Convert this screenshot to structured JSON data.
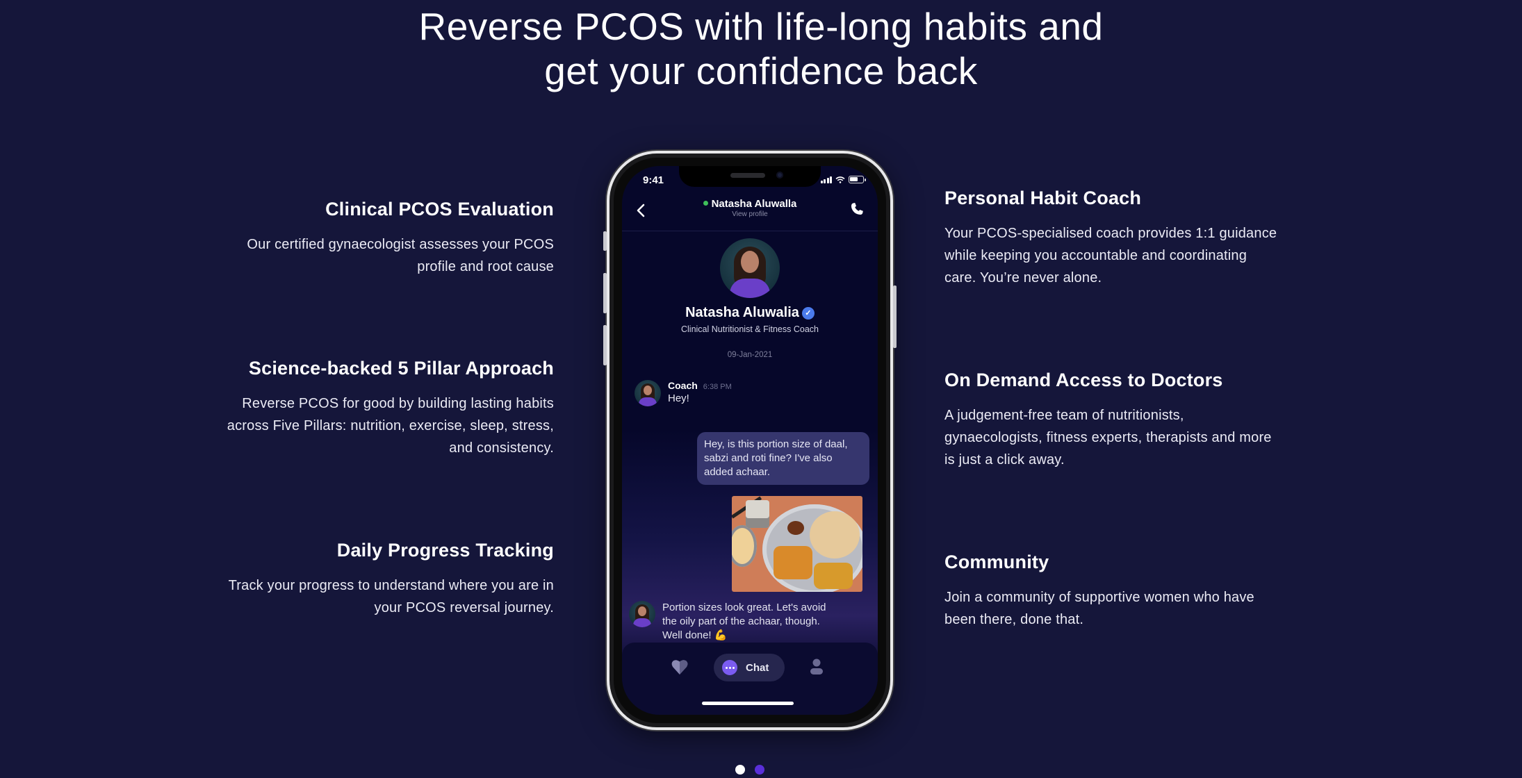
{
  "hero": {
    "title_line1": "Reverse PCOS with life-long habits and",
    "title_line2": "get your confidence back"
  },
  "features_left": [
    {
      "title": "Clinical PCOS Evaluation",
      "body_line1": "Our certified gynaecologist assesses your PCOS",
      "body_line2": "profile and root cause"
    },
    {
      "title": "Science-backed 5 Pillar Approach",
      "body_line1": "Reverse PCOS for good by building lasting habits",
      "body_line2": "across Five Pillars: nutrition, exercise, sleep, stress,",
      "body_line3": "and consistency."
    },
    {
      "title": "Daily Progress Tracking",
      "body_line1": "Track your progress to understand where you are in",
      "body_line2": "your PCOS reversal journey."
    }
  ],
  "features_right": [
    {
      "title": "Personal Habit Coach",
      "body_line1": "Your PCOS-specialised coach provides 1:1 guidance",
      "body_line2": "while keeping you accountable and coordinating",
      "body_line3": "care. You’re never alone."
    },
    {
      "title": "On Demand Access to Doctors",
      "body_line1": "A judgement-free team of nutritionists,",
      "body_line2": "gynaecologists, fitness experts, therapists and more",
      "body_line3": "is just a click away."
    },
    {
      "title": "Community",
      "body_line1": "Join a community of supportive women who have",
      "body_line2": "been there, done that."
    }
  ],
  "phone": {
    "status_time": "9:41",
    "header_name": "Natasha Aluwalla",
    "header_subtitle": "View profile",
    "profile_name": "Natasha Aluwalia",
    "verified_glyph": "✓",
    "profile_role": "Clinical Nutritionist & Fitness Coach",
    "chat_date": "09-Jan-2021",
    "messages": [
      {
        "sender": "Coach",
        "time": "6:38 PM",
        "text": "Hey!"
      },
      {
        "sender": "user",
        "text": "Hey, is this portion size of daal, sabzi and roti fine? I've also added achaar."
      },
      {
        "sender": "user",
        "attachment": "food-photo"
      },
      {
        "sender": "coach",
        "text": "Portion sizes look great. Let's avoid the oily part of the achaar, though. Well done! 💪"
      }
    ],
    "tabs": [
      {
        "icon": "heart-icon",
        "label": ""
      },
      {
        "icon": "chat-icon",
        "label": "Chat",
        "active": true
      },
      {
        "icon": "profile-icon",
        "label": ""
      }
    ],
    "colors": {
      "online": "#3fbf5a",
      "user_bubble": "#36366e",
      "chat_accent": "#7b5cf0",
      "verified": "#4b7bec"
    }
  },
  "carousel": {
    "slides": 2,
    "active_index": 0,
    "colors": {
      "active": "#ffffff",
      "inactive": "#5a2fd9"
    }
  },
  "theme": {
    "background": "#15163a"
  }
}
